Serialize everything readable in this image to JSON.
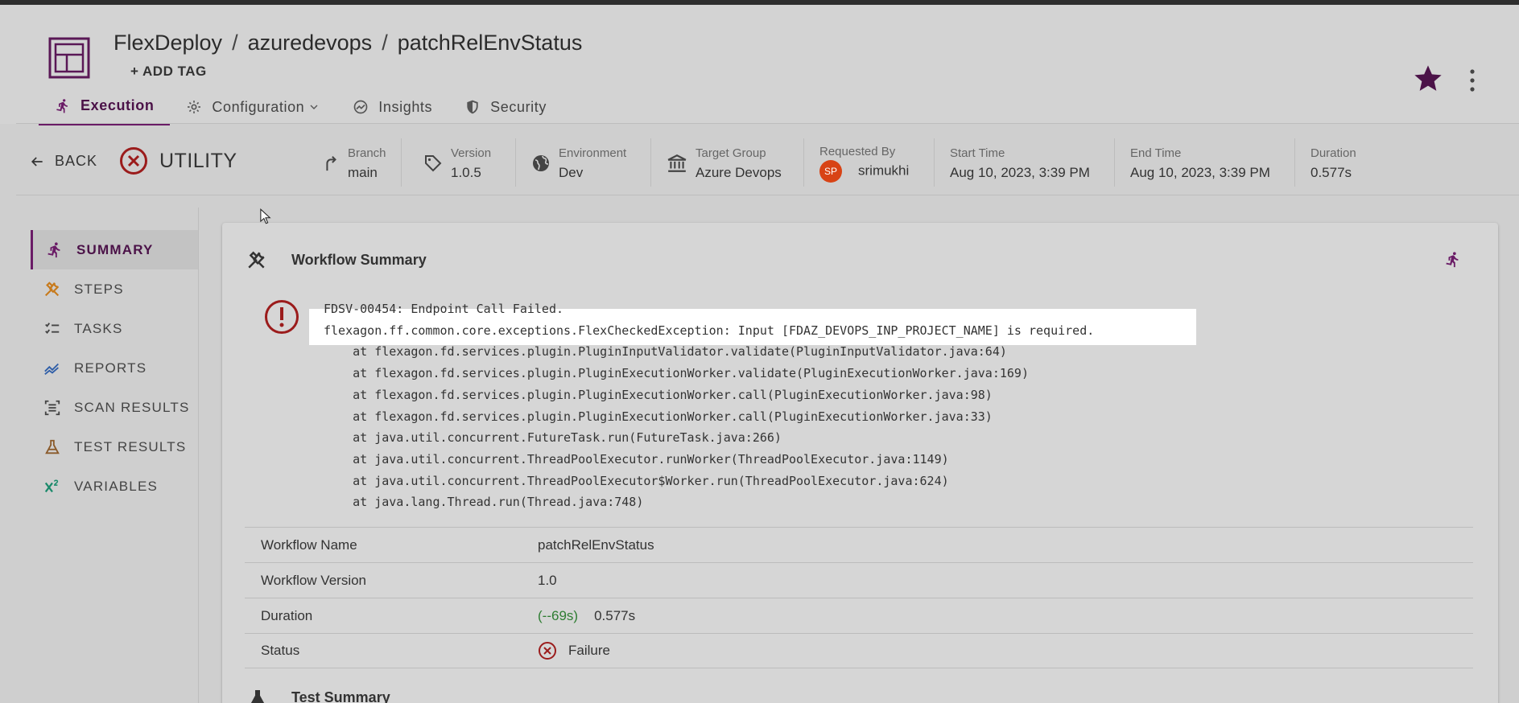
{
  "breadcrumb": [
    "FlexDeploy",
    "azuredevops",
    "patchRelEnvStatus"
  ],
  "add_tag_label": "+ ADD TAG",
  "tabs": [
    {
      "label": "Execution",
      "active": true
    },
    {
      "label": "Configuration",
      "active": false
    },
    {
      "label": "Insights",
      "active": false
    },
    {
      "label": "Security",
      "active": false
    }
  ],
  "info": {
    "back_label": "BACK",
    "type_label": "UTILITY",
    "branch": {
      "label": "Branch",
      "value": "main"
    },
    "version": {
      "label": "Version",
      "value": "1.0.5"
    },
    "environment": {
      "label": "Environment",
      "value": "Dev"
    },
    "target_group": {
      "label": "Target Group",
      "value": "Azure Devops"
    },
    "requested_by": {
      "label": "Requested By",
      "initials": "SP",
      "value": "srimukhi"
    },
    "start_time": {
      "label": "Start Time",
      "value": "Aug 10, 2023, 3:39 PM"
    },
    "end_time": {
      "label": "End Time",
      "value": "Aug 10, 2023, 3:39 PM"
    },
    "duration": {
      "label": "Duration",
      "value": "0.577s"
    }
  },
  "sidebar": {
    "items": [
      {
        "label": "SUMMARY",
        "icon": "run-icon",
        "active": true
      },
      {
        "label": "STEPS",
        "icon": "tools-icon",
        "active": false
      },
      {
        "label": "TASKS",
        "icon": "checklist-icon",
        "active": false
      },
      {
        "label": "REPORTS",
        "icon": "trend-icon",
        "active": false
      },
      {
        "label": "SCAN RESULTS",
        "icon": "scan-icon",
        "active": false
      },
      {
        "label": "TEST RESULTS",
        "icon": "flask-icon",
        "active": false
      },
      {
        "label": "VARIABLES",
        "icon": "variable-icon",
        "active": false
      }
    ]
  },
  "summary": {
    "title": "Workflow Summary",
    "error_lines": [
      "FDSV-00454: Endpoint Call Failed.",
      "flexagon.ff.common.core.exceptions.FlexCheckedException: Input [FDAZ_DEVOPS_INP_PROJECT_NAME] is required.",
      "    at flexagon.fd.services.plugin.PluginInputValidator.validate(PluginInputValidator.java:64)",
      "    at flexagon.fd.services.plugin.PluginExecutionWorker.validate(PluginExecutionWorker.java:169)",
      "    at flexagon.fd.services.plugin.PluginExecutionWorker.call(PluginExecutionWorker.java:98)",
      "    at flexagon.fd.services.plugin.PluginExecutionWorker.call(PluginExecutionWorker.java:33)",
      "    at java.util.concurrent.FutureTask.run(FutureTask.java:266)",
      "    at java.util.concurrent.ThreadPoolExecutor.runWorker(ThreadPoolExecutor.java:1149)",
      "    at java.util.concurrent.ThreadPoolExecutor$Worker.run(ThreadPoolExecutor.java:624)",
      "    at java.lang.Thread.run(Thread.java:748)"
    ],
    "rows": {
      "workflow_name": {
        "key": "Workflow Name",
        "value": "patchRelEnvStatus"
      },
      "workflow_version": {
        "key": "Workflow Version",
        "value": "1.0"
      },
      "duration": {
        "key": "Duration",
        "trend": "(--69s)",
        "value": "0.577s"
      },
      "status": {
        "key": "Status",
        "value": "Failure"
      }
    },
    "next_section_title": "Test Summary"
  },
  "colors": {
    "accent": "#6a1b66",
    "error": "#9b1c1c",
    "trend_green": "#2e7d32",
    "avatar": "#d84315"
  }
}
